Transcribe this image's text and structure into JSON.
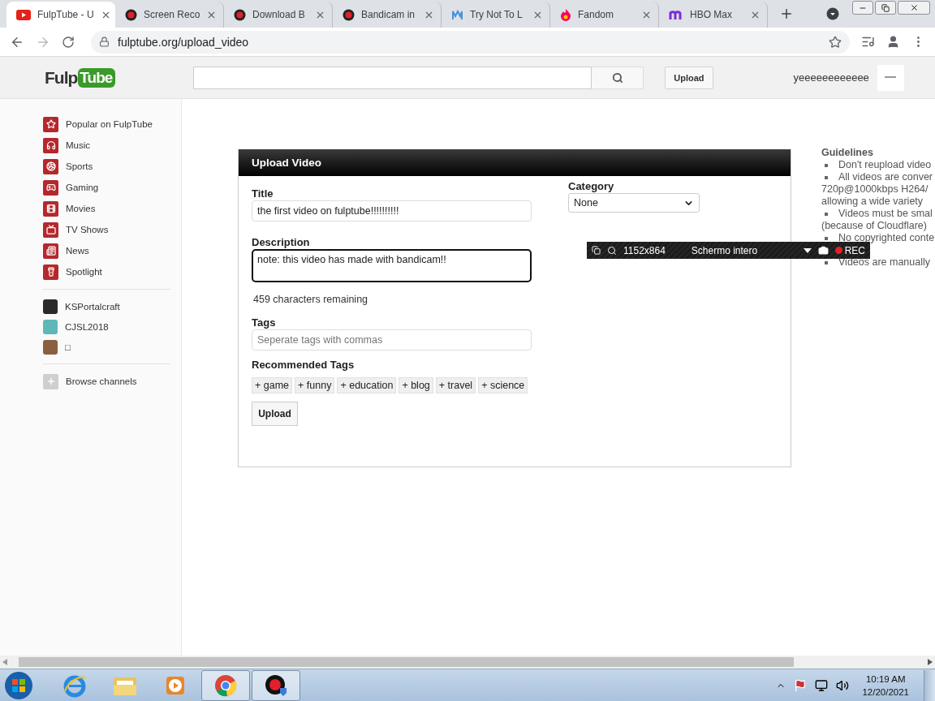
{
  "browser": {
    "tabs": [
      {
        "title": "FulpTube - U",
        "kind": "play",
        "selected": true
      },
      {
        "title": "Screen Reco",
        "kind": "record",
        "selected": false
      },
      {
        "title": "Download B",
        "kind": "record",
        "selected": false
      },
      {
        "title": "Bandicam in",
        "kind": "record",
        "selected": false
      },
      {
        "title": "Try Not To L",
        "kind": "wave",
        "selected": false
      },
      {
        "title": "Fandom",
        "kind": "flame",
        "selected": false
      },
      {
        "title": "HBO Max",
        "kind": "arches",
        "selected": false
      }
    ],
    "address": "fulptube.org/upload_video"
  },
  "header": {
    "logo": {
      "left": "Fulp",
      "right": "Tube"
    },
    "upload": "Upload",
    "username": "yeeeeeeeeeeee"
  },
  "sidebar": {
    "categories": [
      {
        "label": "Popular on FulpTube",
        "kind": "star"
      },
      {
        "label": "Music",
        "kind": "headphones"
      },
      {
        "label": "Sports",
        "kind": "ball"
      },
      {
        "label": "Gaming",
        "kind": "gamepad"
      },
      {
        "label": "Movies",
        "kind": "film"
      },
      {
        "label": "TV Shows",
        "kind": "tv"
      },
      {
        "label": "News",
        "kind": "newspaper"
      },
      {
        "label": "Spotlight",
        "kind": "spotlight"
      }
    ],
    "channels": [
      {
        "label": "KSPortalcraft",
        "color": "#2a2a2a"
      },
      {
        "label": "CJSL2018",
        "color": "#5fb8b8"
      },
      {
        "label": "□",
        "color": "#8a6040"
      }
    ],
    "browse": "Browse channels"
  },
  "form": {
    "heading": "Upload Video",
    "title": {
      "label": "Title",
      "value": "the first video on fulptube!!!!!!!!!!"
    },
    "description": {
      "label": "Description",
      "value": "note: this video has made with bandicam!!",
      "focused": true
    },
    "counter": "459 characters remaining",
    "tags": {
      "label": "Tags",
      "placeholder": "Seperate tags with commas"
    },
    "recommended": {
      "label": "Recommended Tags",
      "tags": [
        "+ game",
        "+ funny",
        "+ education",
        "+ blog",
        "+ travel",
        "+ science"
      ]
    },
    "submit": "Upload",
    "category": {
      "label": "Category",
      "value": "None"
    }
  },
  "guidelines": {
    "heading": "Guidelines",
    "items": [
      {
        "lines": [
          "Don't reupload video"
        ]
      },
      {
        "lines": [
          "All videos are conver",
          "720p@1000kbps H264/",
          "allowing a wide variety"
        ]
      },
      {
        "lines": [
          "Videos must be smal",
          "(because of Cloudflare)"
        ]
      },
      {
        "lines": [
          "No copyrighted conte"
        ]
      },
      {
        "lines": [
          "Videos are manually"
        ]
      }
    ]
  },
  "recorder": {
    "size": "1152x864",
    "mode": "Schermo intero",
    "rec": "REC"
  },
  "taskbar": {
    "apps": [
      {
        "kind": "ie",
        "selected": false
      },
      {
        "kind": "folder",
        "selected": false
      },
      {
        "kind": "player",
        "selected": false
      },
      {
        "kind": "chrome",
        "selected": true
      },
      {
        "kind": "bandicam",
        "selected": true
      }
    ],
    "time": "10:19 AM",
    "date": "12/20/2021"
  }
}
